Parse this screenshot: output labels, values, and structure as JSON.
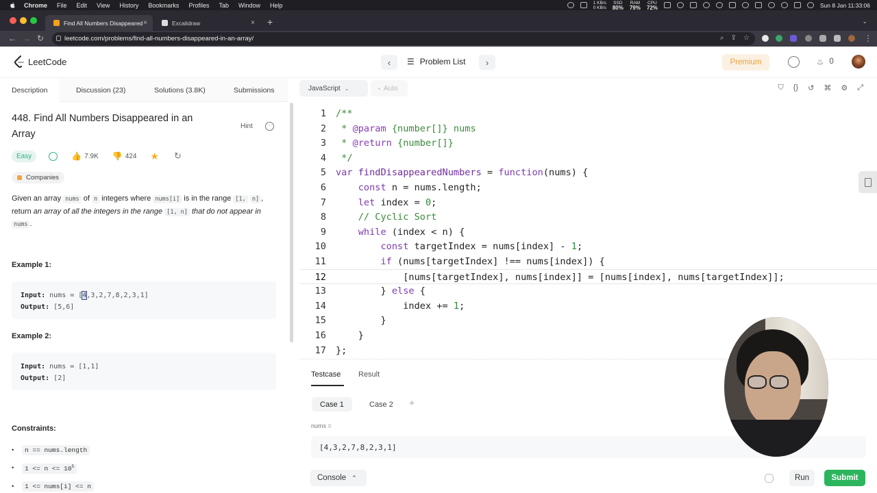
{
  "menubar": {
    "app": "Chrome",
    "items": [
      "File",
      "Edit",
      "View",
      "History",
      "Bookmarks",
      "Profiles",
      "Tab",
      "Window",
      "Help"
    ],
    "net_up": "1 KB/s",
    "net_down": "0 KB/s",
    "ssd_label": "SSD",
    "ssd": "80%",
    "ram_label": "RAM",
    "ram": "79%",
    "cpu_label": "CPU",
    "cpu": "72%",
    "datetime": "Sun 8 Jan 11:33:06"
  },
  "browser": {
    "tabs": [
      {
        "label": "Find All Numbers Disappeared",
        "active": true
      },
      {
        "label": "Excalidraw",
        "active": false
      }
    ],
    "url": "leetcode.com/problems/find-all-numbers-disappeared-in-an-array/"
  },
  "header": {
    "logo_text": "LeetCode",
    "problem_list": "Problem List",
    "premium": "Premium",
    "streak": "0"
  },
  "left_tabs": [
    "Description",
    "Discussion (23)",
    "Solutions (3.8K)",
    "Submissions"
  ],
  "problem": {
    "title": "448. Find All Numbers Disappeared in an Array",
    "hint": "Hint",
    "difficulty": "Easy",
    "likes": "7.9K",
    "dislikes": "424",
    "companies": "Companies",
    "desc_1": "Given an array ",
    "desc_code_nums": "nums",
    "desc_2": " of ",
    "desc_code_n": "n",
    "desc_3": " integers where ",
    "desc_code_numsi": "nums[i]",
    "desc_4": " is in the range ",
    "desc_code_range_a": "[1,",
    "desc_code_range_b": "n]",
    "desc_5": ", return ",
    "desc_italic_1": "an array of all the integers in the range ",
    "desc_code_range": "[1, n]",
    "desc_italic_2": " that do not appear in ",
    "desc_code_nums2": "nums",
    "desc_6": ".",
    "examples": [
      {
        "title": "Example 1:",
        "input_label": "Input:",
        "input_value": " nums = [",
        "input_cursor": "4",
        "input_rest": ",3,2,7,8,2,3,1]",
        "output_label": "Output:",
        "output_value": " [5,6]"
      },
      {
        "title": "Example 2:",
        "input_label": "Input:",
        "input_value": " nums = [1,1]",
        "output_label": "Output:",
        "output_value": " [2]"
      }
    ],
    "constraints_title": "Constraints:",
    "constraints": [
      "n == nums.length",
      "1 <= n <= 10",
      "1 <= nums[i] <= n"
    ],
    "constraint_sup": "5"
  },
  "editor": {
    "language": "JavaScript",
    "mode": "Auto",
    "current_line": 12,
    "lines": [
      "/**",
      " * @param {number[]} nums",
      " * @return {number[]}",
      " */",
      "var findDisappearedNumbers = function(nums) {",
      "    const n = nums.length;",
      "    let index = 0;",
      "    // Cyclic Sort",
      "    while (index < n) {",
      "        const targetIndex = nums[index] - 1;",
      "        if (nums[targetIndex] !== nums[index]) {",
      "            [nums[targetIndex], nums[index]] = [nums[index], nums[targetIndex]];",
      "        } else {",
      "            index += 1;",
      "        }",
      "    }",
      "};"
    ]
  },
  "testcase": {
    "tabs": [
      "Testcase",
      "Result"
    ],
    "cases": [
      "Case 1",
      "Case 2"
    ],
    "param_label": "nums =",
    "param_value": "[4,3,2,7,8,2,3,1]",
    "console": "Console",
    "run": "Run",
    "submit": "Submit"
  }
}
